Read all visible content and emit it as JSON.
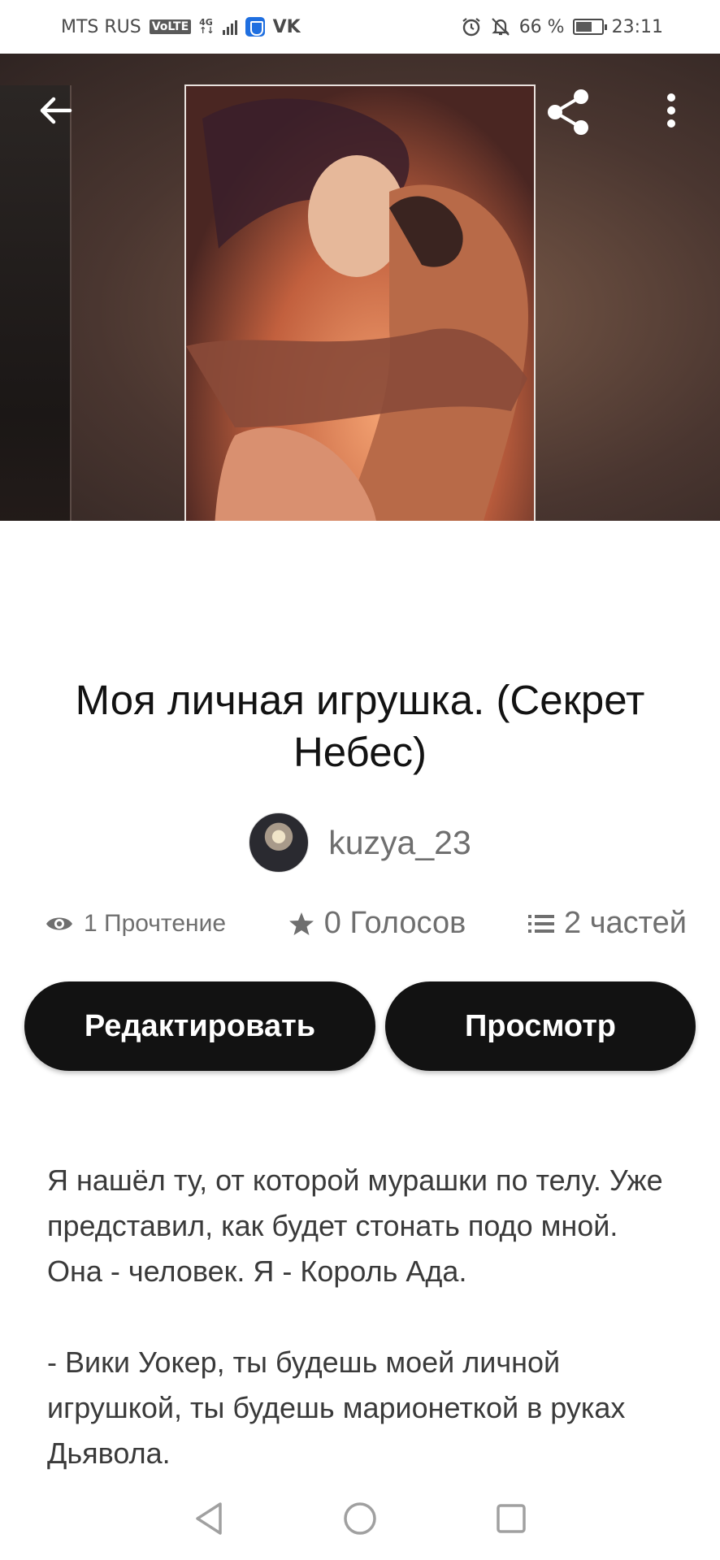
{
  "status_bar": {
    "carrier": "MTS RUS",
    "volte": "VoLTE",
    "network_top": "4G",
    "network_bottom": "↑↓",
    "vk": "VK",
    "battery_percent": "66 %",
    "battery_level": 0.66,
    "time": "23:11"
  },
  "icons": {
    "back": "back-arrow-icon",
    "share": "share-icon",
    "more": "more-vertical-icon",
    "reads": "eye-icon",
    "votes": "star-icon",
    "parts": "list-icon"
  },
  "story": {
    "title": "Моя личная игрушка. (Секрет Небес)",
    "author": "kuzya_23",
    "reads": "1 Прочтение",
    "votes": "0 Голосов",
    "parts": "2 частей"
  },
  "actions": {
    "edit_label": "Редактировать",
    "view_label": "Просмотр"
  },
  "description": {
    "paragraph_1": "Я нашёл ту, от которой мурашки по телу. Уже представил, как будет стонать подо мной. Она - человек. Я - Король Ада.",
    "paragraph_2": "- Вики Уокер, ты будешь моей личной игрушкой, ты будешь марионеткой в руках Дьявола."
  },
  "colors": {
    "primary_button": "#121212",
    "text": "#121212",
    "muted_text": "#6f6f6f"
  }
}
